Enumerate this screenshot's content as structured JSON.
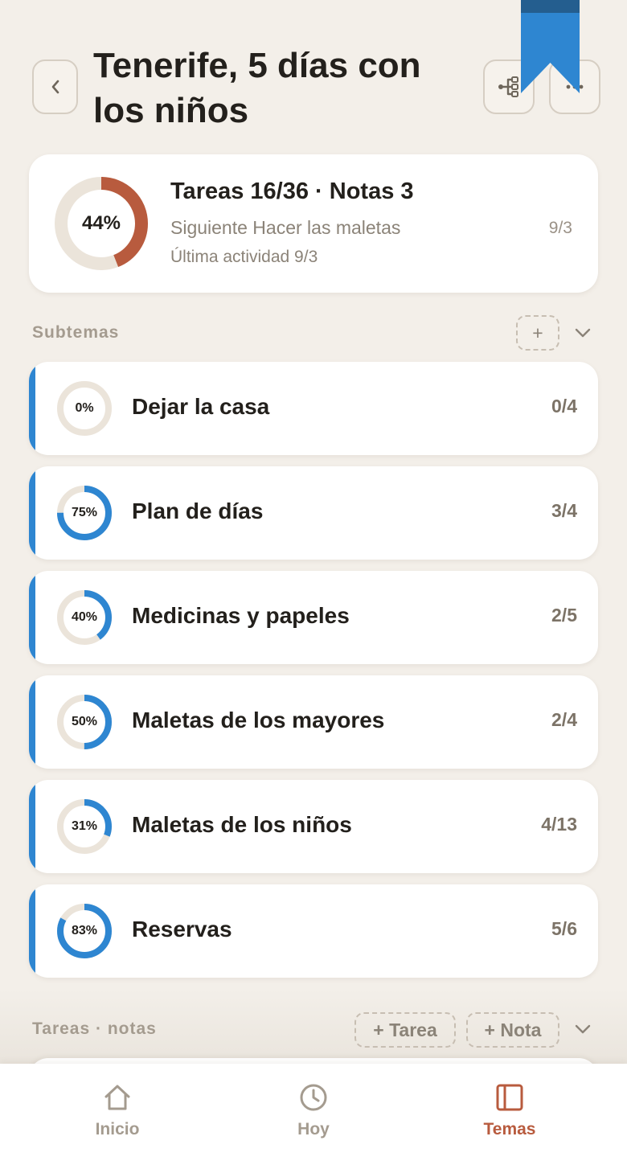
{
  "header": {
    "title": "Tenerife, 5 días con los niños"
  },
  "summary": {
    "percent_label": "44%",
    "progress": 0.44,
    "title": "Tareas 16/36 · Notas 3",
    "next_label": "Siguiente  Hacer las maletas",
    "next_date": "9/3",
    "last_activity": "Última actividad 9/3"
  },
  "subtopics": {
    "label": "Subtemas",
    "add_label": "+",
    "items": [
      {
        "title": "Dejar la casa",
        "percent_label": "0%",
        "progress": 0.0,
        "count": "0/4"
      },
      {
        "title": "Plan de días",
        "percent_label": "75%",
        "progress": 0.75,
        "count": "3/4"
      },
      {
        "title": "Medicinas y papeles",
        "percent_label": "40%",
        "progress": 0.4,
        "count": "2/5"
      },
      {
        "title": "Maletas de los mayores",
        "percent_label": "50%",
        "progress": 0.5,
        "count": "2/4"
      },
      {
        "title": "Maletas de los niños",
        "percent_label": "31%",
        "progress": 0.31,
        "count": "4/13"
      },
      {
        "title": "Reservas",
        "percent_label": "83%",
        "progress": 0.83,
        "count": "5/6"
      }
    ]
  },
  "tasks_notes": {
    "label": "Tareas · notas",
    "add_task_label": "+ Tarea",
    "add_note_label": "+ Nota"
  },
  "tabbar": {
    "items": [
      {
        "label": "Inicio",
        "icon": "home-icon",
        "active": false
      },
      {
        "label": "Hoy",
        "icon": "clock-icon",
        "active": false
      },
      {
        "label": "Temas",
        "icon": "book-icon",
        "active": true
      }
    ]
  },
  "colors": {
    "background": "#f3efe9",
    "accent_blue": "#2e86d1",
    "accent_terracotta": "#b85b3e",
    "ring_track": "#ebe4da",
    "ribbon": "#2e86d1",
    "ribbon_dark": "#245e8f"
  }
}
